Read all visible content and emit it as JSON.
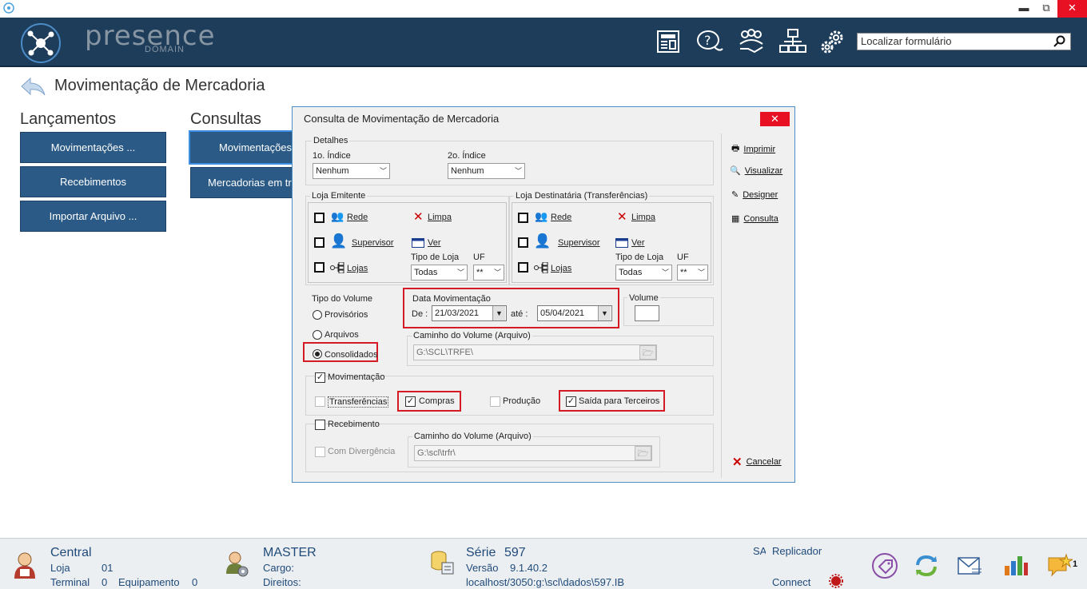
{
  "titlebar": {
    "minimize": "▬",
    "restore": "⧉",
    "close": "✕"
  },
  "header": {
    "logo_main": "presence",
    "logo_sub": "DOMAIN",
    "icons": [
      "news-icon",
      "help-chat-icon",
      "users-hand-icon",
      "network-icon",
      "settings-gears-icon"
    ],
    "search_placeholder": "Localizar formulário"
  },
  "page": {
    "title": "Movimentação de Mercadoria"
  },
  "lancamentos": {
    "title": "Lançamentos",
    "buttons": [
      "Movimentações ...",
      "Recebimentos",
      "Importar Arquivo ..."
    ]
  },
  "consultas": {
    "title": "Consultas",
    "buttons": [
      "Movimentações",
      "Mercadorias em tr"
    ]
  },
  "dialog": {
    "title": "Consulta de Movimentação de Mercadoria",
    "close": "✕",
    "detalhes": {
      "title": "Detalhes",
      "indice1_label": "1o. Índice",
      "indice1_value": "Nenhum",
      "indice2_label": "2o. Índice",
      "indice2_value": "Nenhum"
    },
    "emitente": {
      "title": "Loja Emitente",
      "rede": "Rede",
      "limpa": "Limpa",
      "supervisor": "Supervisor",
      "ver": "Ver",
      "lojas": "Lojas",
      "tipo_loja_label": "Tipo de Loja",
      "tipo_loja_value": "Todas",
      "uf_label": "UF",
      "uf_value": "**"
    },
    "destinataria": {
      "title": "Loja Destinatária (Transferências)",
      "rede": "Rede",
      "limpa": "Limpa",
      "supervisor": "Supervisor",
      "ver": "Ver",
      "lojas": "Lojas",
      "tipo_loja_label": "Tipo de Loja",
      "tipo_loja_value": "Todas",
      "uf_label": "UF",
      "uf_value": "**"
    },
    "tipo_volume": {
      "title": "Tipo do Volume",
      "options": [
        "Provisórios",
        "Arquivos",
        "Consolidados"
      ],
      "selected": "Consolidados"
    },
    "data_mov": {
      "title": "Data Movimentação",
      "de_label": "De :",
      "de_value": "21/03/2021",
      "ate_label": "até :",
      "ate_value": "05/04/2021"
    },
    "volume": {
      "title": "Volume",
      "value": ""
    },
    "caminho1": {
      "title": "Caminho do Volume (Arquivo)",
      "value": "G:\\SCL\\TRFE\\"
    },
    "movimentacao": {
      "title": "Movimentação",
      "checked": true,
      "transferencias": "Transferências",
      "transferencias_checked": false,
      "compras": "Compras",
      "compras_checked": true,
      "producao": "Produção",
      "producao_checked": false,
      "saida": "Saída para Terceiros",
      "saida_checked": true
    },
    "recebimento": {
      "title": "Recebimento",
      "checked": false,
      "com_divergencia": "Com Divergência",
      "caminho_title": "Caminho do Volume (Arquivo)",
      "caminho_value": "G:\\scl\\trfr\\"
    },
    "side": {
      "imprimir": "Imprimir",
      "visualizar": "Visualizar",
      "designer": "Designer",
      "consulta": "Consulta",
      "cancelar": "Cancelar"
    }
  },
  "footer": {
    "central": "Central",
    "loja_label": "Loja",
    "loja_value": "01",
    "terminal_label": "Terminal",
    "terminal_value": "0",
    "equipamento_label": "Equipamento",
    "equipamento_value": "0",
    "user": "MASTER",
    "cargo_label": "Cargo:",
    "direitos_label": "Direitos:",
    "serie_label": "Série",
    "serie_value": "597",
    "versao_label": "Versão",
    "versao_value": "9.1.40.2",
    "db_path": "localhost/3050:g:\\scl\\dados\\597.IB",
    "sa": "SA",
    "replicador": "Replicador",
    "connect": "Connect",
    "notification_count": "1"
  }
}
